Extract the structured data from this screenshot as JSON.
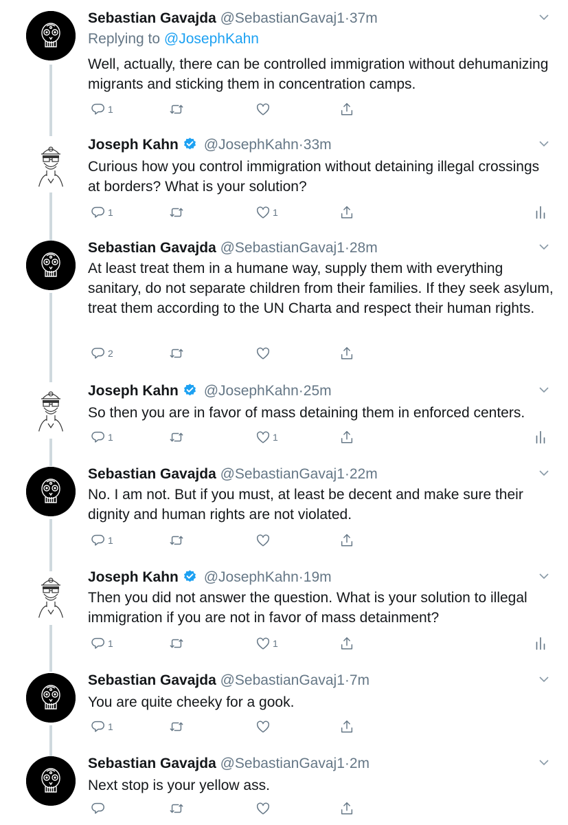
{
  "tweets": [
    {
      "name": "Sebastian Gavajda",
      "handle": "@SebastianGavaj1",
      "dot": "·",
      "time": "37m",
      "verified": false,
      "replying_prefix": "Replying to ",
      "replying_to": "@JosephKahn",
      "text": "Well, actually, there can be controlled immigration without dehumanizing migrants and sticking them in concentration camps.",
      "replies": "1",
      "likes": "",
      "has_stats": false,
      "avatar": "skull-avatar"
    },
    {
      "name": "Joseph Kahn",
      "handle": "@JosephKahn",
      "dot": "·",
      "time": "33m",
      "verified": true,
      "text": "Curious how you control immigration without detaining illegal crossings at borders? What is your solution?",
      "replies": "1",
      "likes": "1",
      "has_stats": true,
      "avatar": "sketch-avatar"
    },
    {
      "name": "Sebastian Gavajda",
      "handle": "@SebastianGavaj1",
      "dot": "·",
      "time": "28m",
      "verified": false,
      "text": "At least treat them in a humane way, supply them with everything sanitary, do not separate children from their families. If they seek asylum, treat them according to the UN Charta and respect their human rights.",
      "replies": "2",
      "likes": "",
      "has_stats": false,
      "avatar": "skull-avatar"
    },
    {
      "name": "Joseph Kahn",
      "handle": "@JosephKahn",
      "dot": "·",
      "time": "25m",
      "verified": true,
      "text": "So then you are in favor of mass detaining them in enforced centers.",
      "replies": "1",
      "likes": "1",
      "has_stats": true,
      "avatar": "sketch-avatar"
    },
    {
      "name": "Sebastian Gavajda",
      "handle": "@SebastianGavaj1",
      "dot": "·",
      "time": "22m",
      "verified": false,
      "text": "No. I am not. But if you must, at least be decent and make sure their dignity and human rights are not violated.",
      "replies": "1",
      "likes": "",
      "has_stats": false,
      "avatar": "skull-avatar"
    },
    {
      "name": "Joseph Kahn",
      "handle": "@JosephKahn",
      "dot": "·",
      "time": "19m",
      "verified": true,
      "text": "Then you did not answer the question. What is your solution to illegal immigration if you are not in favor of mass detainment?",
      "replies": "1",
      "likes": "1",
      "has_stats": true,
      "avatar": "sketch-avatar"
    },
    {
      "name": "Sebastian Gavajda",
      "handle": "@SebastianGavaj1",
      "dot": "·",
      "time": "7m",
      "verified": false,
      "text": "You are quite cheeky for a gook.",
      "replies": "1",
      "likes": "",
      "has_stats": false,
      "avatar": "skull-avatar"
    },
    {
      "name": "Sebastian Gavajda",
      "handle": "@SebastianGavaj1",
      "dot": "·",
      "time": "2m",
      "verified": false,
      "text": "Next stop is your yellow ass.",
      "replies": "",
      "likes": "",
      "has_stats": false,
      "avatar": "skull-avatar"
    }
  ],
  "colors": {
    "accent": "#1da1f2",
    "muted": "#657786",
    "text": "#14171a",
    "thread_line": "#cfd9de"
  },
  "icons": [
    "reply-icon",
    "retweet-icon",
    "like-icon",
    "share-icon",
    "stats-icon",
    "chevron-down-icon",
    "verified-badge-icon"
  ]
}
